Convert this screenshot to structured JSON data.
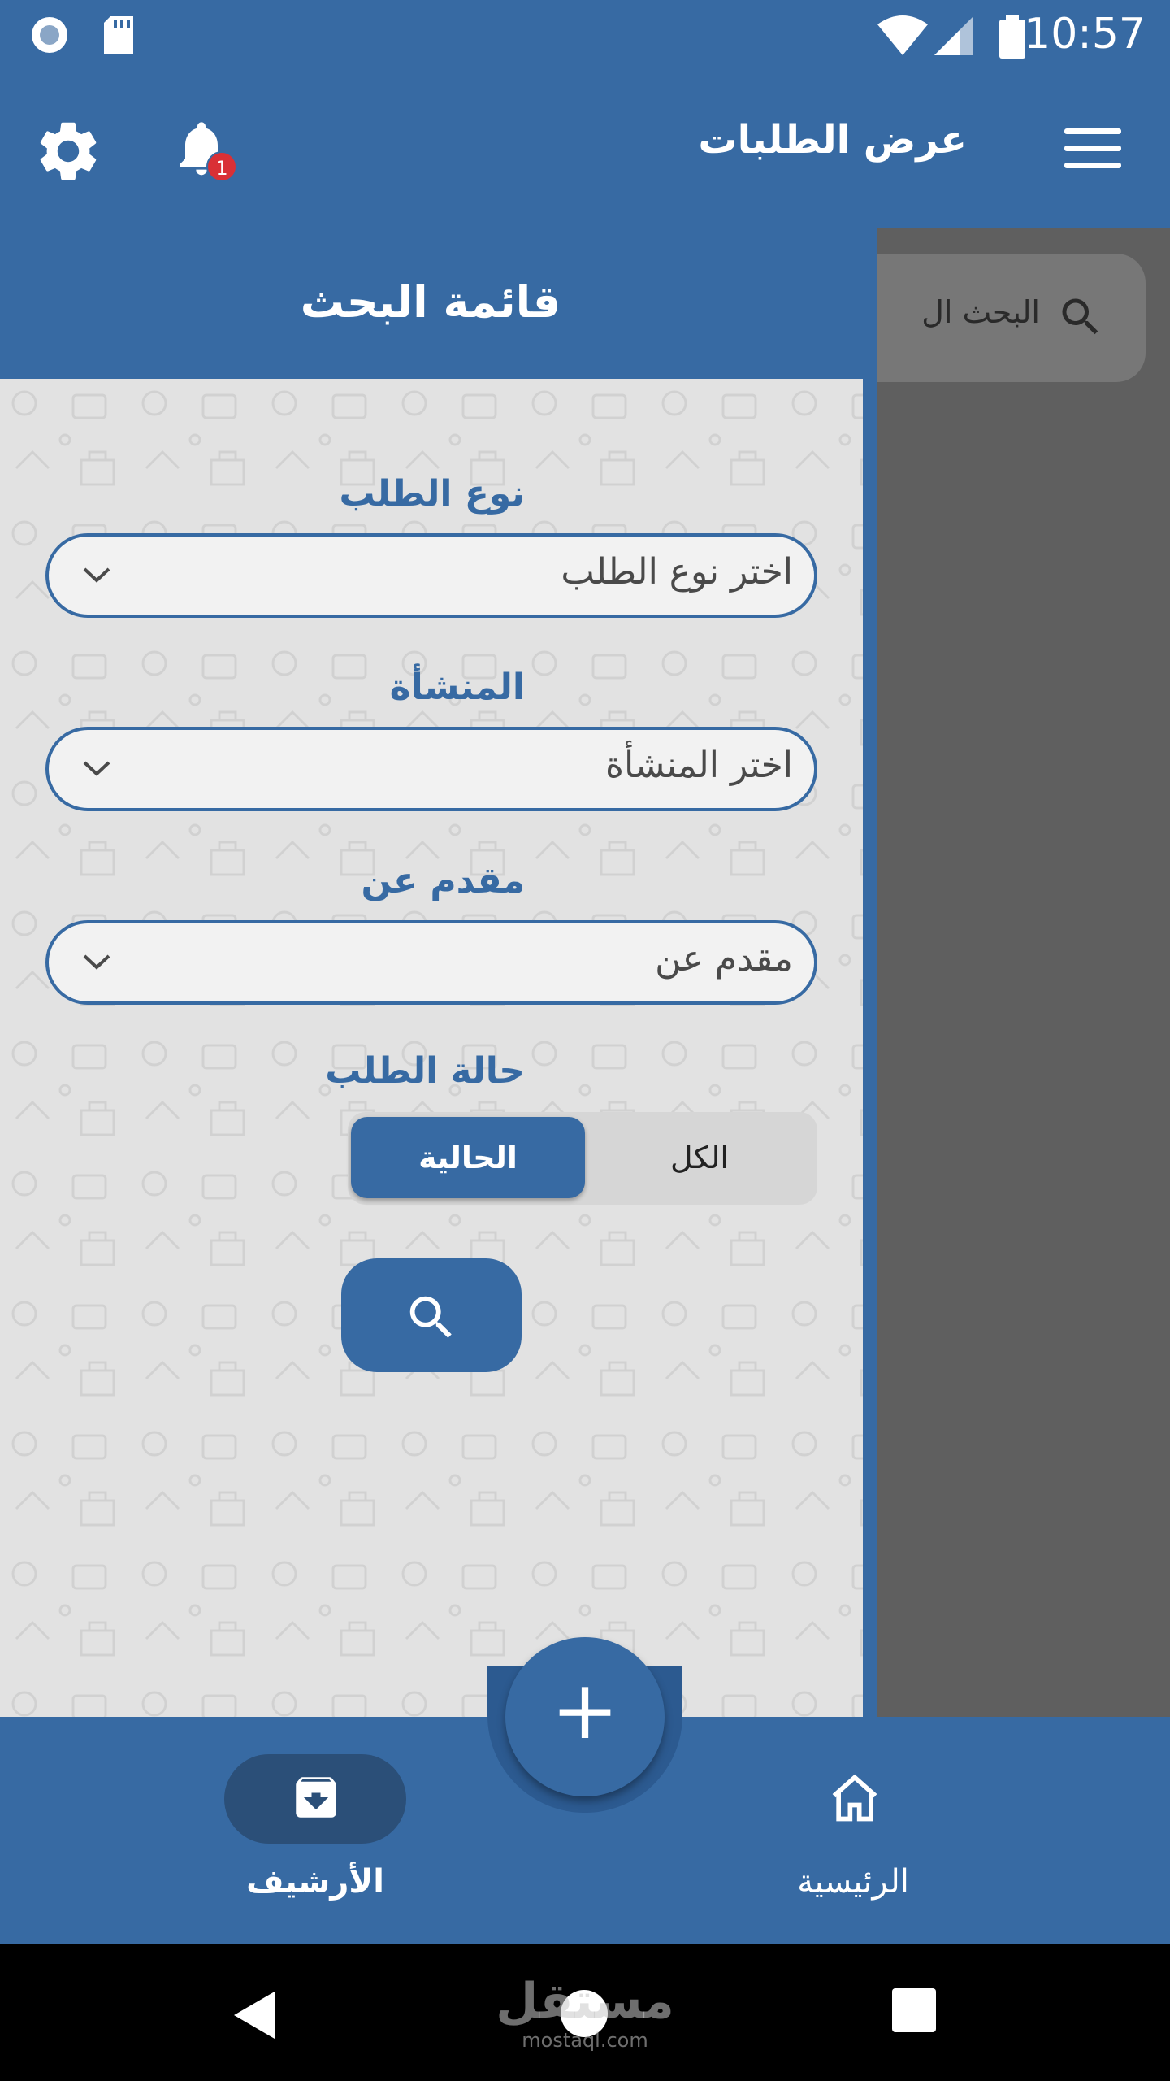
{
  "status_bar": {
    "time": "10:57"
  },
  "app_bar": {
    "title": "عرض الطلبات",
    "notification_count": "1"
  },
  "background_page": {
    "search_placeholder": "البحث ال"
  },
  "drawer": {
    "title": "قائمة البحث",
    "fields": [
      {
        "label": "نوع الطلب",
        "placeholder": "اختر نوع الطلب"
      },
      {
        "label": "المنشأة",
        "placeholder": "اختر المنشأة"
      },
      {
        "label": "مقدم عن",
        "placeholder": "مقدم عن"
      }
    ],
    "status": {
      "label": "حالة الطلب",
      "options": [
        "الحالية",
        "الكل"
      ],
      "selected": "الحالية"
    }
  },
  "bottom_nav": {
    "items": [
      {
        "label": "الأرشيف",
        "icon": "archive-icon",
        "active": true
      },
      {
        "label": "الرئيسية",
        "icon": "home-icon",
        "active": false
      }
    ],
    "fab_icon": "+"
  },
  "watermark": {
    "text": "مستقل",
    "sub": "mostaql.com"
  },
  "colors": {
    "primary": "#376aa3",
    "badge": "#d93036",
    "drawer_bg": "#e2e2e2"
  }
}
